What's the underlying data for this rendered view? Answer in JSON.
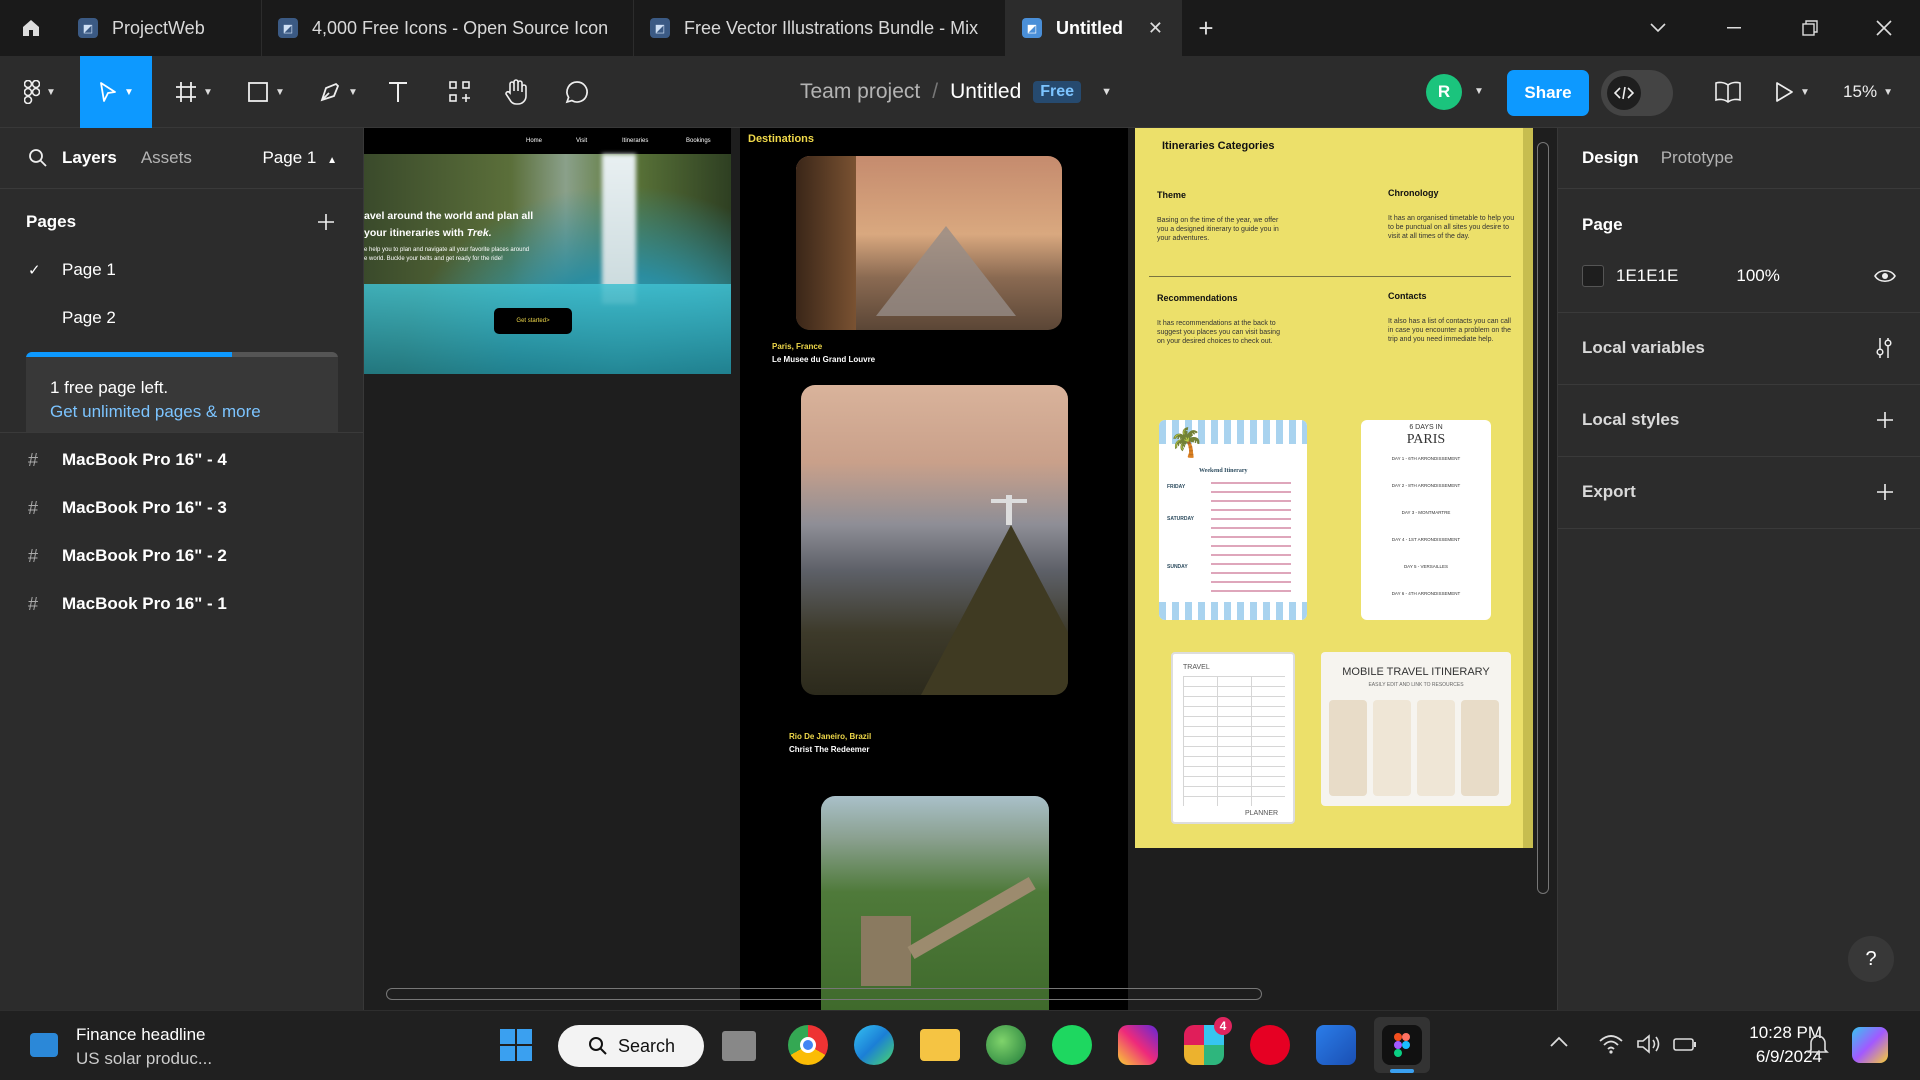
{
  "browser": {
    "tabs": [
      {
        "label": "ProjectWeb"
      },
      {
        "label": "4,000 Free Icons - Open Source Icon"
      },
      {
        "label": "Free Vector Illustrations Bundle - Mix"
      },
      {
        "label": "Untitled"
      }
    ],
    "new_tab": "+",
    "close_tab": "✕"
  },
  "toolbar": {
    "team": "Team project",
    "slash": "/",
    "file_name": "Untitled",
    "plan_badge": "Free",
    "avatar_letter": "R",
    "share_label": "Share",
    "zoom": "15%"
  },
  "left_panel": {
    "tabs": {
      "layers": "Layers",
      "assets": "Assets"
    },
    "page_selector": "Page 1",
    "pages_heading": "Pages",
    "pages": [
      {
        "label": "Page 1",
        "checked": true
      },
      {
        "label": "Page 2",
        "checked": false
      }
    ],
    "upsell": {
      "line1": "1 free page left.",
      "link": "Get unlimited pages & more",
      "progress": 0.66
    },
    "layers": [
      {
        "label": "MacBook Pro 16\" - 4"
      },
      {
        "label": "MacBook Pro 16\" - 3"
      },
      {
        "label": "MacBook Pro 16\" - 2"
      },
      {
        "label": "MacBook Pro 16\" - 1"
      }
    ]
  },
  "right_panel": {
    "tabs": {
      "design": "Design",
      "prototype": "Prototype"
    },
    "page_heading": "Page",
    "bg_hex": "1E1E1E",
    "bg_opacity": "100%",
    "sections": [
      {
        "label": "Local variables"
      },
      {
        "label": "Local styles"
      },
      {
        "label": "Export"
      }
    ],
    "help": "?"
  },
  "canvas": {
    "frame1": {
      "nav": [
        "Home",
        "Visit",
        "Itineraries",
        "Bookings"
      ],
      "hero_line1": "avel around the world and plan all",
      "hero_line2_a": "your itineraries with ",
      "hero_line2_b": "Trek.",
      "hero_sub1": "e help you to plan and navigate all your favorite places around",
      "hero_sub2": "e world. Buckle your belts and get ready for the ride!",
      "cta": "Get started>"
    },
    "frame2": {
      "heading": "Destinations",
      "items": [
        {
          "place": "Paris, France",
          "name": "Le Musee du Grand Louvre"
        },
        {
          "place": "Rio De Janeiro, Brazil",
          "name": "Christ The Redeemer"
        }
      ]
    },
    "frame3": {
      "heading": "Itineraries Categories",
      "cells": [
        {
          "title": "Theme",
          "body": "Basing on the time of the year, we offer you a designed itinerary to guide you in your adventures."
        },
        {
          "title": "Chronology",
          "body": "It has an organised timetable to help you to be punctual on all sites you desire to visit at all times of the day."
        },
        {
          "title": "Recommendations",
          "body": "It has recommendations at the back to suggest you places you can visit basing on your desired choices to check out."
        },
        {
          "title": "Contacts",
          "body": "It also has a list of contacts you can call in case you encounter a problem on the trip and you need immediate help."
        }
      ],
      "card_weekend": {
        "line1": "Weekend Itinerary",
        "days": [
          "FRIDAY",
          "SATURDAY",
          "SUNDAY"
        ]
      },
      "card_paris": {
        "line1": "6 DAYS IN",
        "line2": "PARIS",
        "days": [
          "DAY 1 - 6TH ARRONDISSEMENT",
          "DAY 2 - 8TH ARRONDISSEMENT",
          "DAY 3 - MONTMARTRE",
          "DAY 4 - 1ST ARRONDISSEMENT",
          "DAY 5 - VERSAILLES",
          "DAY 6 - 4TH ARRONDISSEMENT"
        ]
      },
      "card_planner": {
        "top": "TRAVEL",
        "bottom": "PLANNER"
      },
      "card_mobile": {
        "title": "MOBILE TRAVEL ITINERARY",
        "sub": "EASILY EDIT AND LINK TO RESOURCES"
      }
    }
  },
  "taskbar": {
    "news_title": "Finance headline",
    "news_sub": "US solar produc...",
    "search_label": "Search",
    "time": "10:28 PM",
    "date": "6/9/2024",
    "slack_badge": "4"
  }
}
